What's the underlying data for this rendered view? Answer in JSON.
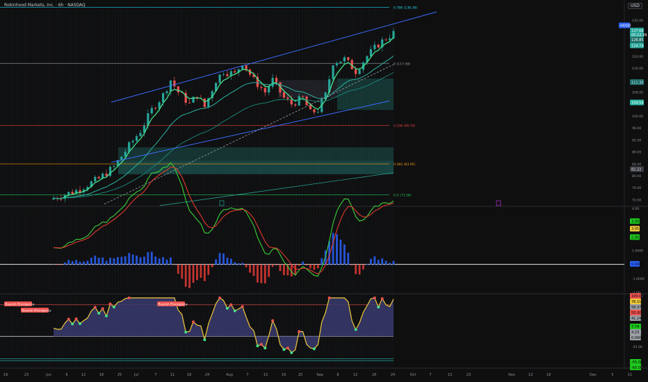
{
  "header": {
    "title": "Robinhood Markets, Inc. · 6h · NASDAQ",
    "currency": "USD"
  },
  "colors": {
    "background": "#0f0f10",
    "up": "#26a69a",
    "down": "#ef5350",
    "channel": "#3d6bff",
    "ema_fast": "#45e08a",
    "ema_mid": "#2bb3a3",
    "macd": "#3ad13a",
    "signal": "#e33b2f",
    "osc_line": "#f0c93a",
    "osc_fill": "#3a3a6e",
    "fib_0786": "#22d3ee",
    "fib_05": "#9aa0a6",
    "fib_0236": "#ef4444",
    "fib_0382": "#f59e0b",
    "fib_05b": "#22c55e"
  },
  "chart_data": [
    {
      "type": "candlestick",
      "title": "Robinhood Markets, Inc. · 6h · NASDAQ",
      "symbol": "HOOD",
      "ylim": [
        70,
        136
      ],
      "y_ticks": [
        "132.00",
        "128.00",
        "124.00",
        "120.00",
        "116.00",
        "112.00",
        "108.00",
        "104.00",
        "100.00",
        "96.00",
        "92.00",
        "88.00",
        "84.00",
        "80.00",
        "76.00",
        "72.00"
      ],
      "x_ticks": [
        "19",
        "23",
        "Jun",
        "6",
        "12",
        "18",
        "25",
        "Jul",
        "7",
        "11",
        "18",
        "24",
        "Aug",
        "7",
        "13",
        "19",
        "25",
        "Sep",
        "8",
        "12",
        "18",
        "24",
        "Oct",
        "7",
        "13",
        "23",
        "Nov",
        "13",
        "19",
        "Dec",
        "5",
        "11"
      ],
      "close_path": [
        [
          0,
          72.5
        ],
        [
          6,
          75
        ],
        [
          12,
          79
        ],
        [
          16,
          83
        ],
        [
          20,
          90
        ],
        [
          23,
          95
        ],
        [
          26,
          102
        ],
        [
          29,
          107
        ],
        [
          31,
          112
        ],
        [
          33,
          108
        ],
        [
          36,
          104
        ],
        [
          38,
          107
        ],
        [
          40,
          103
        ],
        [
          43,
          112
        ],
        [
          45,
          115
        ],
        [
          48,
          114
        ],
        [
          50,
          118
        ],
        [
          53,
          112
        ],
        [
          56,
          108
        ],
        [
          58,
          112
        ],
        [
          61,
          106
        ],
        [
          63,
          104
        ],
        [
          66,
          106
        ],
        [
          68,
          101
        ],
        [
          70,
          102
        ],
        [
          72,
          107
        ],
        [
          74,
          118
        ],
        [
          77,
          119
        ],
        [
          80,
          115
        ],
        [
          83,
          120
        ],
        [
          86,
          124
        ],
        [
          88,
          126
        ],
        [
          90,
          127.66
        ]
      ],
      "price_labels": [
        {
          "label": "HOOD",
          "value": 130.3
        },
        {
          "label": "127.66",
          "value": 128.6
        },
        {
          "label": "05:22:29",
          "value": 127.2
        },
        {
          "label": "126.85",
          "value": 125.5
        },
        {
          "label": "124.74",
          "value": 123.6
        },
        {
          "label": "111.30",
          "value": 111.3
        },
        {
          "label": "104.54",
          "value": 104.5
        },
        {
          "label": "82.22",
          "value": 82.2
        }
      ],
      "fib_levels": [
        {
          "label": "0.786 (136.38)",
          "value": 136.38,
          "color": "#22d3ee"
        },
        {
          "label": "0 (117.58)",
          "value": 117.58,
          "color": "#9aa0a6"
        },
        {
          "label": "0.236 (96.79)",
          "value": 96.79,
          "color": "#ef4444"
        },
        {
          "label": "0.382 (83.95)",
          "value": 83.95,
          "color": "#f59e0b"
        },
        {
          "label": "0.5 (73.58)",
          "value": 73.58,
          "color": "#22c55e"
        }
      ]
    },
    {
      "type": "line",
      "name": "macd",
      "ylim": [
        -2,
        4
      ],
      "y_ticks": [
        "4.00",
        "1.0000",
        "-1.0000",
        "-2.00"
      ],
      "labels": [
        {
          "label": "3.09",
          "value": 3.09,
          "color": "#1ec81e"
        },
        {
          "label": "3.05",
          "value": 2.55,
          "color": "#f0c93a"
        },
        {
          "label": "2.00",
          "value": 1.95,
          "color": "#1ec81e"
        },
        {
          "label": "0.0423",
          "value": 0.04,
          "color": "#2962ff"
        }
      ]
    },
    {
      "type": "area",
      "name": "oscillator",
      "ylim": [
        -75,
        100
      ],
      "y_ticks": [
        "100.00",
        "-25.00",
        "-75.00"
      ],
      "annotations": [
        "Bearish Divergence",
        "Bearish Divergence",
        "Bearish Divergence"
      ],
      "labels": [
        {
          "label": "100.00",
          "value": 100,
          "color": "#ef5350"
        },
        {
          "label": "78.11",
          "value": 78.11,
          "color": "#f0c93a"
        },
        {
          "label": "58.37",
          "value": 58.37,
          "color": "#9aa0a6"
        },
        {
          "label": "55.00",
          "value": 55,
          "color": "#ef5350"
        },
        {
          "label": "41.24",
          "value": 41.24,
          "color": "#9aa0a6"
        },
        {
          "label": "7.74",
          "value": 7.74,
          "color": "#1ec81e"
        },
        {
          "label": "4.23",
          "value": 4.23,
          "color": "#9aa0a6"
        },
        {
          "label": "0.0000",
          "value": 0,
          "color": "#9aa0a6"
        },
        {
          "label": "-55.00",
          "value": -55,
          "color": "#1ec81e"
        },
        {
          "label": "-60.00",
          "value": -60,
          "color": "#1ec81e"
        }
      ]
    }
  ]
}
